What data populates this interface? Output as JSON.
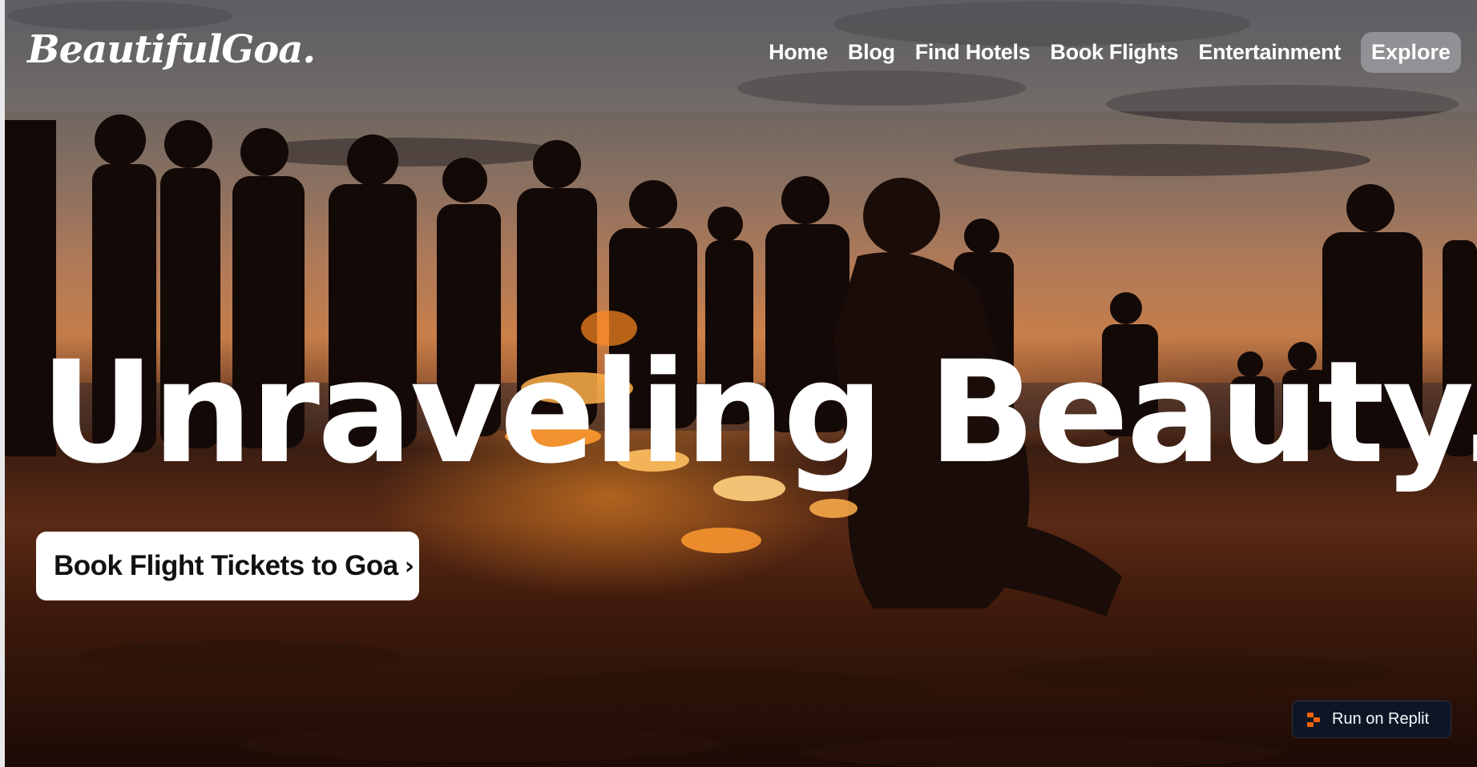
{
  "header": {
    "logo": "BeautifulGoa.",
    "nav": {
      "home": "Home",
      "blog": "Blog",
      "find_hotels": "Find Hotels",
      "book_flights": "Book Flights",
      "entertainment": "Entertainment",
      "explore": "Explore"
    }
  },
  "hero": {
    "title": "Unraveling Beauty.",
    "cta_label": "Book Flight Tickets to Goa",
    "cta_icon": "chevron-right-icon"
  },
  "badge": {
    "label": "Run on Replit",
    "icon": "replit-icon",
    "colors": {
      "background": "#0e1525",
      "icon": "#f26207"
    }
  }
}
